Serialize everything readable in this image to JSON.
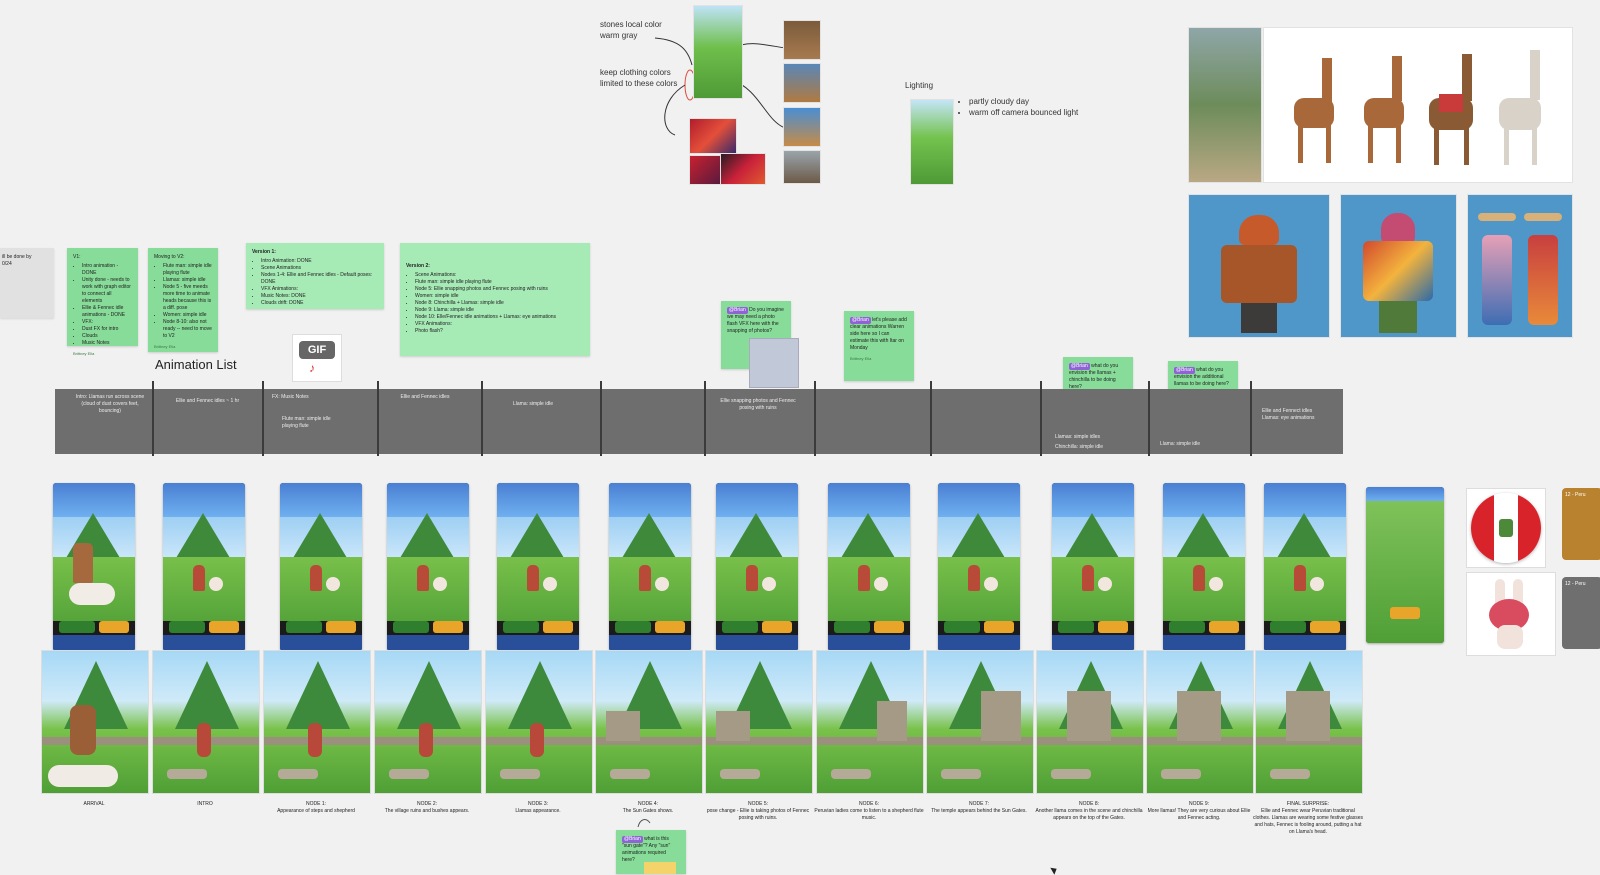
{
  "ref_notes": {
    "stones": "stones local color warm gray",
    "clothing": "keep clothing colors limited to these colors",
    "lighting_title": "Lighting",
    "lighting_items": [
      "partly cloudy day",
      "warm off camera bounced light"
    ]
  },
  "left_gray_note": [
    "ill be done by",
    "0/24"
  ],
  "stickies": {
    "v1_title": "V1:",
    "v1_items": [
      "Intro animation - DONE",
      "Unity done - needs to work with graph editor to connect all elements",
      "Ellie & Fennec idle animations - DONE",
      "VFX:",
      "Dust FX for intro",
      "Clouds",
      "Music Notes"
    ],
    "v2_title": "Moving to V2:",
    "v2_items": [
      "Flute man: simple idle playing flute",
      "Llamas: simple idle",
      "Node 5 - five meeds more time to animate heads because this is a diff. pose",
      "Women: simple idle",
      "Node 8-10: also not ready -- need to move to V2"
    ],
    "version1_title": "Version 1:",
    "version1_items": [
      "Intro Animation: DONE",
      "Scene Animations",
      "Nodes 1-4: Ellie and Fennec idles - Default poses: DONE",
      "VFX Animations:",
      "Music Notes: DONE",
      "Clouds drift: DONE"
    ],
    "version2_title": "Version 2:",
    "version2_items": [
      "Scene Animations:",
      "Flute man: simple idle playing flute",
      "Node 5: Ellie snapping photos and Fennec posing with ruins",
      "Women: simple idle",
      "Node 8: Chinchilla + Llamas: simple idle",
      "Node 9: Llama: simple idle",
      "Node 10: Elle/Fennec idle animations + Llamas: eye animations",
      "VFX Animations:",
      "Photo flash?"
    ],
    "q_photo": "Do you imagine we may need a photo flash VFX here with the snapping of photos?",
    "q_clear": "let's please add clear animations Warren side here so I can estimate this with Itar on Monday",
    "q_chinchilla": "what do you envision the llamas + chinchilla to be doing here?",
    "q_additional": "what do you envision the additional llamas to be doing here?",
    "q_sungate": "what is this \"sun gate\"? Any \"sun\" animations required here?",
    "mention": "@Brian",
    "author": "Brittney Ella"
  },
  "gif_label": "GIF",
  "section_title": "Animation List",
  "timeline": [
    "Intro: Llamas run across scene (cloud of dust covers feet, bouncing)",
    "Ellie and Fennec idles ~ 1 hr",
    "FX: Music Notes",
    "Flute man: simple idle playing flute",
    "Ellie and Fennec idles",
    "Llama: simple idle",
    "Ellie snapping photos and Fennec posing with ruins",
    "Llamas: simple idles",
    "Chinchilla: simple idle",
    "Llama: simple idle",
    "Ellie and Fennect idles",
    "Llamas: eye animations"
  ],
  "captions": [
    {
      "title": "ARRIVAL",
      "text": ""
    },
    {
      "title": "INTRO",
      "text": ""
    },
    {
      "title": "NODE 1:",
      "text": "Appearance of steps and shepherd"
    },
    {
      "title": "NODE 2:",
      "text": "The village ruins and bushes appears."
    },
    {
      "title": "NODE 3:",
      "text": "Llamas appearance."
    },
    {
      "title": "NODE 4:",
      "text": "The Sun Gates shows."
    },
    {
      "title": "NODE 5:",
      "text": "pose change - Ellie is taking photos of Fennec posing with ruins."
    },
    {
      "title": "NODE 6:",
      "text": "Peruvian ladies come to listen to a shepherd flute music."
    },
    {
      "title": "NODE 7:",
      "text": "The temple appears behind the Sun Gates."
    },
    {
      "title": "NODE 8:",
      "text": "Another llama comes in the scene and chinchilla appears on the top of the Gates."
    },
    {
      "title": "NODE 9:",
      "text": "More llamas! They are very curious about Ellie and Fennec acting."
    },
    {
      "title": "FINAL SURPRISE:",
      "text": "Ellie and Fennec wear Peruvian traditional clothes. Llamas are wearing some festive glasses and hats, Fennec is fooling around, putting a hat on Llama's head."
    }
  ],
  "phone_ui": {
    "level": "Level 4567",
    "button": "Start"
  },
  "right_cards": [
    "12 - Peru",
    "12 - Peru"
  ],
  "colors": {
    "sticky": "#86dc98",
    "timeline": "#6e6e6e",
    "canvas": "#f1f1f1",
    "mention": "#8f63d6",
    "flag_red": "#d8232a"
  }
}
